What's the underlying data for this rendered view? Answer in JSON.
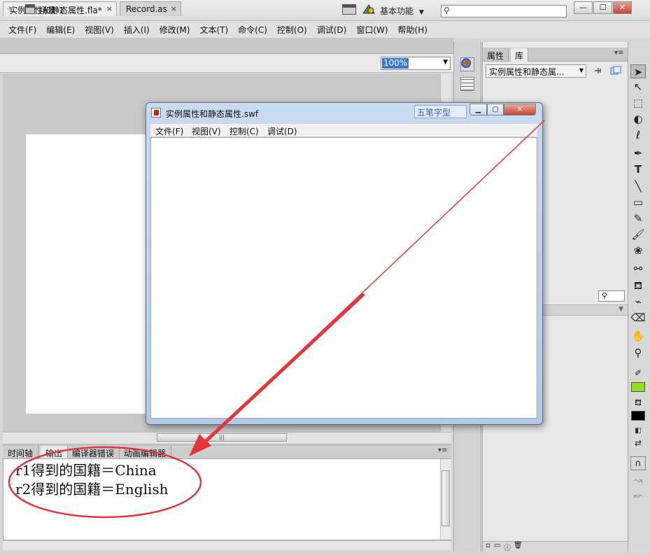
{
  "app": {
    "logo": "Fl",
    "workspace": "基本功能",
    "search_placeholder": ""
  },
  "menubar": [
    "文件(F)",
    "编辑(E)",
    "视图(V)",
    "插入(I)",
    "修改(M)",
    "文本(T)",
    "命令(C)",
    "控制(O)",
    "调试(D)",
    "窗口(W)",
    "帮助(H)"
  ],
  "document_tabs": [
    {
      "label": "实例属性和静态属性.fla*",
      "close": "×"
    },
    {
      "label": "Record.as",
      "close": "×"
    }
  ],
  "editbar": {
    "scene": "场景 1",
    "zoom": "100%"
  },
  "bottom_panel": {
    "tabs": [
      "时间轴",
      "输出",
      "编译器错误",
      "动画编辑器"
    ],
    "output_lines": [
      "r1得到的国籍＝China",
      "r2得到的国籍＝English"
    ]
  },
  "right_panel": {
    "tabs": [
      "属性",
      "库"
    ],
    "library_select": "实例属性和静态属..."
  },
  "swf_window": {
    "title": "实例属性和静态属性.swf",
    "ime_badge": "五笔字型",
    "menu": [
      "文件(F)",
      "视图(V)",
      "控制(C)",
      "调试(D)"
    ]
  },
  "colors": {
    "annotation_red": "#e0383a",
    "stroke_color": "#8ee01b",
    "fill_color": "#000000"
  }
}
